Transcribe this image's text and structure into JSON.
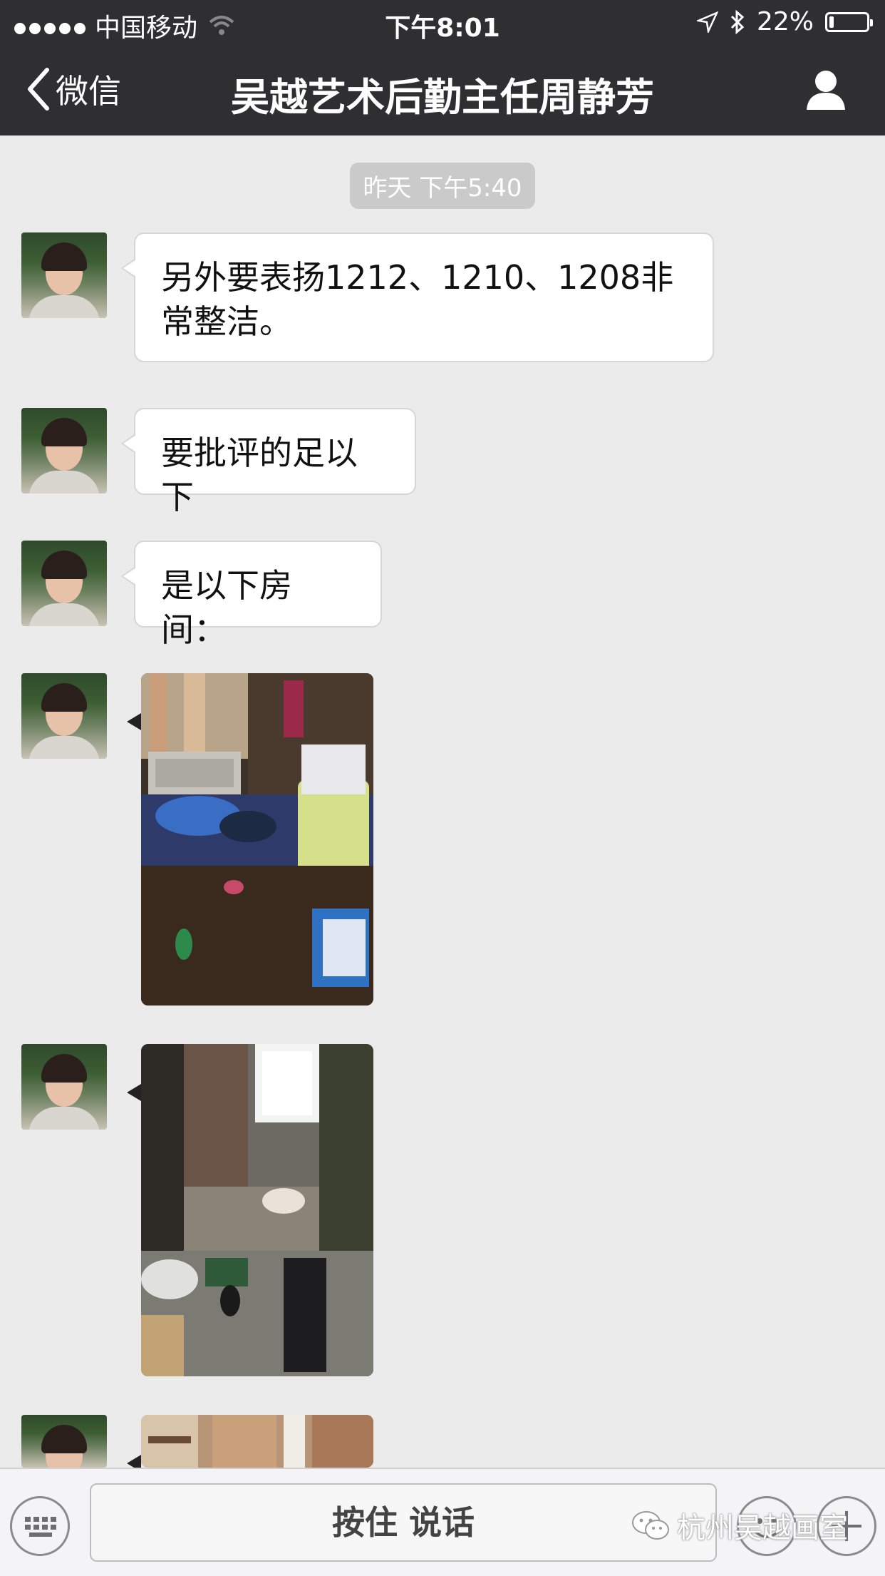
{
  "status_bar": {
    "carrier": "中国移动",
    "time": "下午8:01",
    "battery": "22%",
    "battery_level": 0.22,
    "icons": [
      "signal-dots-icon",
      "wifi-icon",
      "location-icon",
      "bluetooth-icon",
      "battery-icon"
    ]
  },
  "nav": {
    "back_label": "微信",
    "title": "吴越艺术后勤主任周静芳",
    "profile_icon": "person-icon"
  },
  "chat": {
    "timestamp": "昨天 下午5:40",
    "messages": [
      {
        "type": "text",
        "text": "另外要表扬1212、1210、1208非常整洁。"
      },
      {
        "type": "text",
        "text": "要批评的足以下"
      },
      {
        "type": "text",
        "text": "是以下房间："
      },
      {
        "type": "image",
        "description": "messy-dorm-room-photo"
      },
      {
        "type": "image",
        "description": "messy-dorm-room-photo"
      },
      {
        "type": "image",
        "description": "dorm-room-photo-partial"
      }
    ]
  },
  "input_bar": {
    "hold_to_talk": "按住 说话",
    "keyboard_icon": "keyboard-icon",
    "emoji_icon": "emoji-icon",
    "plus_icon": "plus-icon"
  },
  "watermark": {
    "text": "杭州吴越画室",
    "icon": "wechat-logo-icon"
  },
  "colors": {
    "nav_background": "#2f2f32",
    "chat_background": "#ebebeb",
    "bubble_background": "#ffffff",
    "timestamp_background": "#cacaca"
  }
}
